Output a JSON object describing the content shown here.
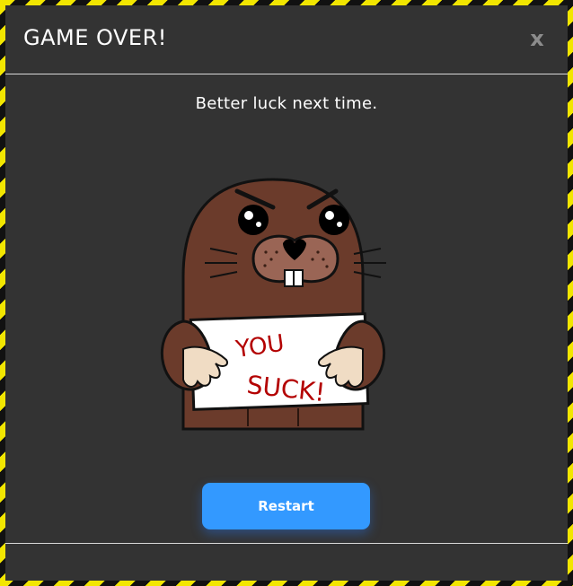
{
  "modal": {
    "title": "GAME OVER!",
    "close_label": "x",
    "message": "Better luck next time.",
    "sign_line1": "YOU",
    "sign_line2": "SUCK!",
    "restart_label": "Restart",
    "mole_icon": "mole-holding-sign-illustration"
  },
  "colors": {
    "border_stripe_yellow": "#f2e600",
    "border_stripe_black": "#111111",
    "modal_background": "#333333",
    "divider": "#d9d9d9",
    "button": "#3399ff",
    "mole_fur": "#6b3b2b",
    "sign_text": "#b30000"
  }
}
